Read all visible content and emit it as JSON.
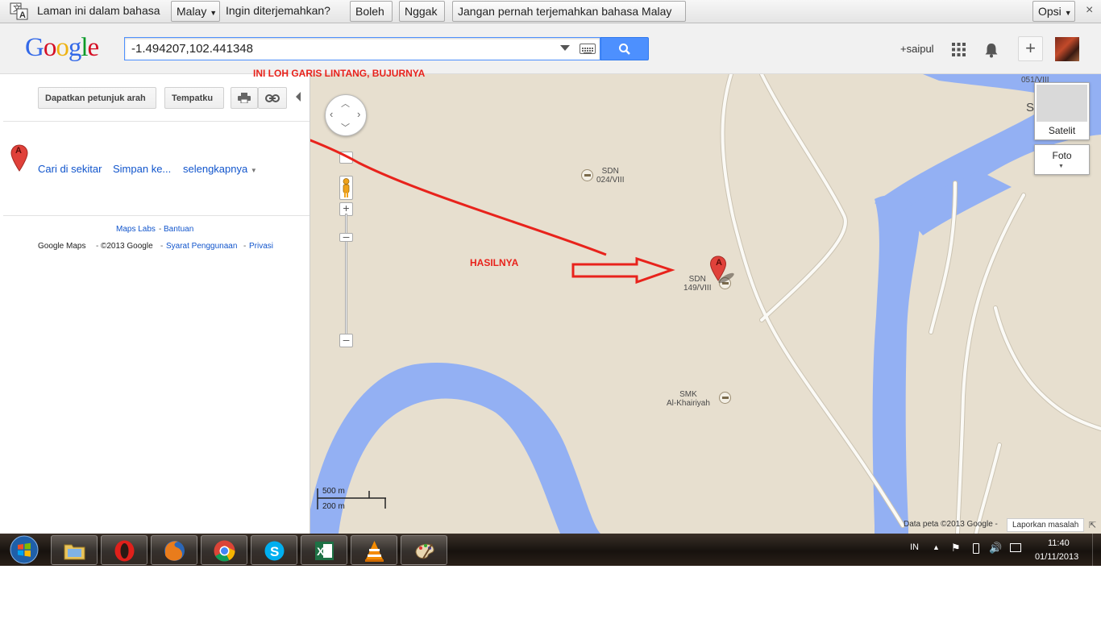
{
  "translate_bar": {
    "message": "Laman ini dalam bahasa",
    "language": "Malay",
    "question": "Ingin diterjemahkan?",
    "yes_label": "Boleh",
    "no_label": "Nggak",
    "never_label": "Jangan pernah terjemahkan bahasa Malay",
    "options_label": "Opsi"
  },
  "header": {
    "logo_letters": [
      "G",
      "o",
      "o",
      "g",
      "l",
      "e"
    ],
    "logo_colors": [
      "#3369e8",
      "#d50f25",
      "#eeb211",
      "#3369e8",
      "#009925",
      "#d50f25"
    ],
    "search_value": "-1.494207,102.441348",
    "user_name": "+saipul",
    "accent_color": "#4d90fe"
  },
  "left_panel": {
    "directions_button": "Dapatkan petunjuk arah",
    "places_button": "Tempatku",
    "marker_letter": "A",
    "search_nearby": "Cari di sekitar",
    "save_to": "Simpan ke...",
    "more": "selengkapnya",
    "labs": "Maps Labs",
    "help": "Bantuan",
    "product": "Google Maps",
    "copyright": "©2013 Google",
    "terms": "Syarat Penggunaan",
    "privacy": "Privasi",
    "separator": "-"
  },
  "map": {
    "pois": [
      {
        "name": "SDN\n024/VIII",
        "line1": "SDN",
        "line2": "024/VIII"
      },
      {
        "name": "SDN 149/VIII",
        "line1": "SDN",
        "line2": "149/VIII"
      },
      {
        "name": "SMK Al-Khairiyah",
        "line1": "SMK",
        "line2": "Al-Khairiyah"
      }
    ],
    "partial_label_top": "051/VIII",
    "partial_label_side": "S",
    "marker_letter": "A",
    "satellite_label": "Satelit",
    "photo_label": "Foto",
    "scale_metric": "500 m",
    "scale_imperial": "200 m",
    "attribution": "Data peta ©2013 Google -",
    "report_label": "Laporkan masalah",
    "river_color": "#93b0f3",
    "land_color": "#e7dfcf",
    "road_color": "#fbfaf6"
  },
  "annotations": {
    "coords_note": "INI LOH GARIS LINTANG, BUJURNYA",
    "result_note": "HASILNYA",
    "color": "#e8231c"
  },
  "taskbar": {
    "apps": [
      "explorer-icon",
      "opera-icon",
      "firefox-icon",
      "chrome-icon",
      "skype-icon",
      "excel-icon",
      "vlc-icon",
      "paint-icon"
    ],
    "language": "IN",
    "time": "11:40",
    "date": "01/11/2013"
  }
}
